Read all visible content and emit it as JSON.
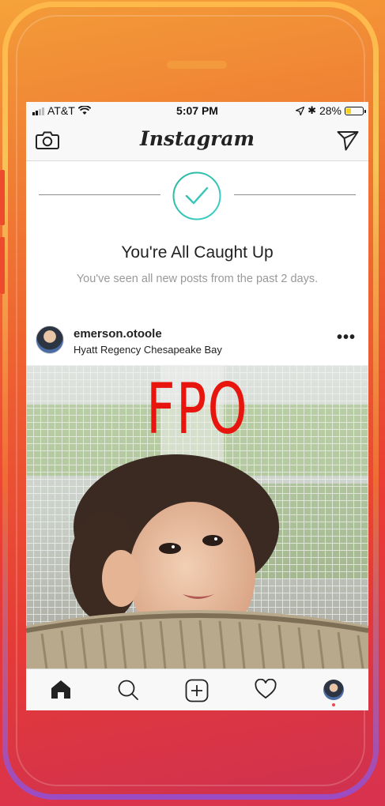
{
  "status_bar": {
    "carrier": "AT&T",
    "time": "5:07 PM",
    "battery": "28%",
    "battery_level": 0.28
  },
  "header": {
    "logo": "Instagram",
    "left_icon": "camera-icon",
    "right_icon": "direct-send-icon"
  },
  "caught_up": {
    "title": "You're All Caught Up",
    "subtitle": "You've seen all new posts from the past 2 days.",
    "icon": "checkmark-circle-icon",
    "accent": "#2ec4b6"
  },
  "post": {
    "username": "emerson.otoole",
    "location": "Hyatt Regency Chesapeake Bay",
    "overlay_text": "FPO",
    "more_label": "•••"
  },
  "tab_bar": {
    "items": [
      "home-icon",
      "search-icon",
      "add-post-icon",
      "activity-heart-icon",
      "profile-avatar"
    ],
    "notification_color": "#ed4956"
  }
}
